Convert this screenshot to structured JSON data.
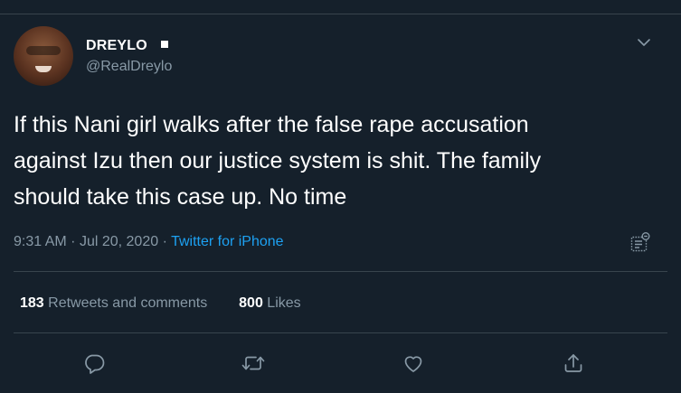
{
  "tweet": {
    "display_name": "DREYLO",
    "handle": "@RealDreylo",
    "text": "If this Nani girl walks after the false rape accusation\nagainst Izu then our justice system is shit. The family\nshould take this case up. No time",
    "time": "9:31 AM",
    "date": "Jul 20, 2020",
    "separator": "·",
    "source": "Twitter for iPhone"
  },
  "stats": {
    "retweets_count": "183",
    "retweets_label": "Retweets and comments",
    "likes_count": "800",
    "likes_label": "Likes"
  },
  "actions": [
    {
      "name": "reply",
      "icon": "comment-icon"
    },
    {
      "name": "retweet",
      "icon": "retweet-icon"
    },
    {
      "name": "like",
      "icon": "heart-icon"
    },
    {
      "name": "share",
      "icon": "share-icon"
    }
  ],
  "colors": {
    "background": "#15202b",
    "text": "#ffffff",
    "secondary_text": "#8899a6",
    "link": "#1da1f2",
    "divider": "#38444d"
  }
}
